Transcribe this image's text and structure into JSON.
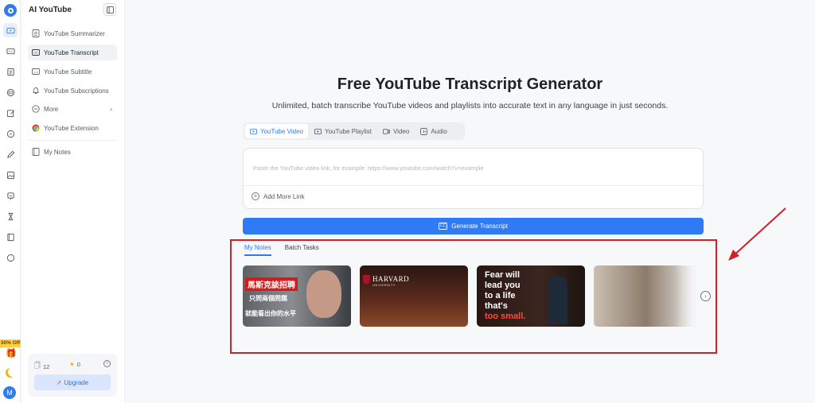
{
  "app": {
    "title": "AI YouTube"
  },
  "rail": {
    "icons": [
      "logo-icon",
      "video-icon",
      "cc-icon",
      "document-icon",
      "monitor-icon",
      "edit-icon",
      "chat-icon",
      "pen-icon",
      "image-icon",
      "robot-icon",
      "hourglass-icon",
      "book-icon",
      "circle-icon"
    ],
    "promo_label": "30% Off",
    "avatar_initial": "M"
  },
  "sidebar": {
    "items": [
      {
        "label": "YouTube Summarizer",
        "icon": "document-icon"
      },
      {
        "label": "YouTube Transcript",
        "icon": "cc-icon",
        "active": true
      },
      {
        "label": "YouTube Subtitle",
        "icon": "subtitle-icon"
      },
      {
        "label": "YouTube Subscriptions",
        "icon": "bell-icon"
      },
      {
        "label": "More",
        "icon": "more-icon"
      },
      {
        "label": "YouTube Extension",
        "icon": "chrome-icon"
      },
      {
        "label": "My Notes",
        "icon": "notebook-icon"
      }
    ],
    "stats": {
      "files": "12",
      "points": "0"
    },
    "upgrade_label": "Upgrade"
  },
  "main": {
    "title": "Free YouTube Transcript Generator",
    "subtitle": "Unlimited, batch transcribe YouTube videos and playlists into accurate text in any language in just seconds.",
    "source_tabs": [
      {
        "label": "YouTube Video",
        "active": true
      },
      {
        "label": "YouTube Playlist"
      },
      {
        "label": "Video"
      },
      {
        "label": "Audio"
      }
    ],
    "input": {
      "placeholder": "Paste the YouTube video link, for example: https://www.youtube.com/watch?v=example",
      "value": ""
    },
    "add_more_label": "Add More Link",
    "generate_label": "Generate Transcript",
    "notes_tabs": [
      {
        "label": "My Notes",
        "active": true
      },
      {
        "label": "Batch Tasks"
      }
    ],
    "thumbnails": [
      {
        "lines": [
          "馬斯克談招聘",
          "只問兩個問題",
          "就能看出你的水平"
        ]
      },
      {
        "lines": [
          "HARVARD",
          "UNIVERSITY"
        ]
      },
      {
        "lines": [
          "Fear will",
          "lead you",
          "to a life",
          "that's",
          "too small."
        ]
      },
      {
        "lines": []
      }
    ]
  },
  "colors": {
    "accent": "#2f7bf5",
    "annotation": "#d0202a",
    "promo": "#ffd23a"
  }
}
